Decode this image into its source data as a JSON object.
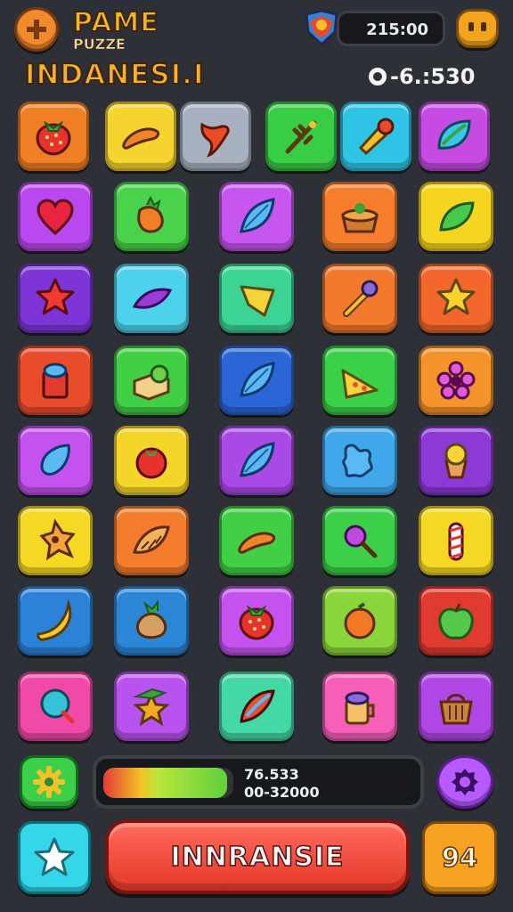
{
  "header": {
    "title_line1": "PAME",
    "title_line2": "PUZZE",
    "title_line3": "INDANESI.I",
    "timer": "215:00",
    "stat": "-6.:530"
  },
  "grid": {
    "rows": [
      [
        {
          "color": "#f07f24",
          "icon": "strawberry-icon"
        },
        {
          "color": "#f6d42f",
          "icon": "sausage-icon"
        },
        {
          "color": "#a8b1bf",
          "icon": "chili-icon"
        },
        {
          "color": "#39cd45",
          "icon": "twig-icon"
        },
        {
          "color": "#2fc4e5",
          "icon": "drill-icon"
        },
        {
          "color": "#c64be3",
          "icon": "leaf-icon"
        }
      ],
      [
        {
          "color": "#ba48f0",
          "icon": "heart-icon"
        },
        {
          "color": "#49d34b",
          "icon": "carrot-icon"
        },
        {
          "color": "#c755f0",
          "icon": "blue-leaf-icon"
        },
        {
          "color": "#f57d2c",
          "icon": "pie-icon"
        },
        {
          "color": "#f5d51f",
          "icon": "green-leaf-icon"
        }
      ],
      [
        {
          "color": "#7e35d8",
          "icon": "red-star-icon"
        },
        {
          "color": "#4dd2ec",
          "icon": "purple-leaf-icon"
        },
        {
          "color": "#3bd495",
          "icon": "yellow-gem-icon"
        },
        {
          "color": "#f37a2c",
          "icon": "wrench-icon"
        },
        {
          "color": "#f3672c",
          "icon": "yellow-star-icon"
        }
      ],
      [
        {
          "color": "#e84c2b",
          "icon": "cup-icon"
        },
        {
          "color": "#41cf44",
          "icon": "bread-icon"
        },
        {
          "color": "#2a66d6",
          "icon": "blue-leaf-icon"
        },
        {
          "color": "#3ad148",
          "icon": "cheese-icon"
        },
        {
          "color": "#f4932a",
          "icon": "flower-icon"
        }
      ],
      [
        {
          "color": "#c352ef",
          "icon": "drop-icon"
        },
        {
          "color": "#f4d52a",
          "icon": "tomato-icon"
        },
        {
          "color": "#a94ae6",
          "icon": "blue-leaf-icon"
        },
        {
          "color": "#3fa7ea",
          "icon": "splash-icon"
        },
        {
          "color": "#8c39d6",
          "icon": "ice-cream-icon"
        }
      ],
      [
        {
          "color": "#f5d824",
          "icon": "cookie-icon"
        },
        {
          "color": "#f37d2d",
          "icon": "croissant-icon"
        },
        {
          "color": "#41cf46",
          "icon": "sausage-icon"
        },
        {
          "color": "#3ccf48",
          "icon": "lollipop-icon"
        },
        {
          "color": "#f5d824",
          "icon": "candy-cane-icon"
        }
      ],
      [
        {
          "color": "#2c82d8",
          "icon": "banana-icon"
        },
        {
          "color": "#2c86d6",
          "icon": "ginger-icon"
        },
        {
          "color": "#c552ef",
          "icon": "strawberry-icon"
        },
        {
          "color": "#8ad63a",
          "icon": "orange-icon"
        },
        {
          "color": "#e13a2e",
          "icon": "apple-icon"
        }
      ],
      [
        {
          "color": "#f049a9",
          "icon": "balloon-icon"
        },
        {
          "color": "#b853f0",
          "icon": "star-hat-icon"
        },
        {
          "color": "#45d8a7",
          "icon": "feather-icon"
        },
        {
          "color": "#f55fb8",
          "icon": "mug-icon"
        },
        {
          "color": "#b147e7",
          "icon": "basket-icon"
        }
      ]
    ]
  },
  "bottom": {
    "progress_value": 0.95,
    "progress_line1": "76.533",
    "progress_line2": "00-32000",
    "main_button": "INNRANSIE",
    "count": "94"
  }
}
